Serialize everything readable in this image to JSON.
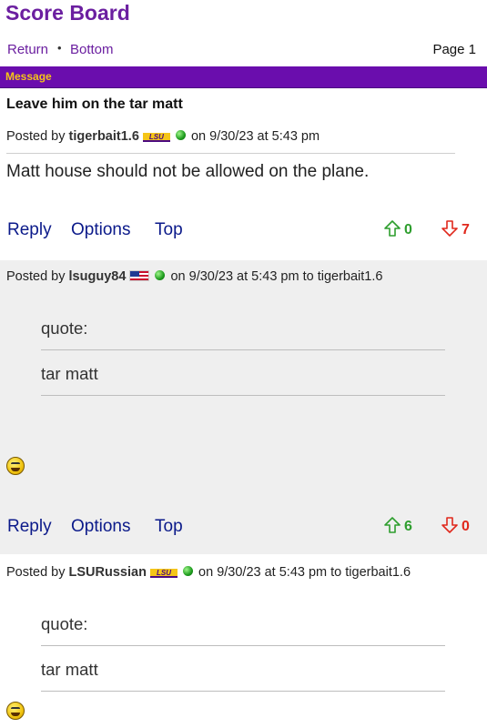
{
  "header": {
    "site_title": "Score Board",
    "nav": {
      "return_label": "Return",
      "separator": "•",
      "bottom_label": "Bottom"
    },
    "page_label": "Page 1"
  },
  "message_bar": {
    "label": "Message"
  },
  "thread": {
    "title": "Leave him on the tar matt"
  },
  "posts": [
    {
      "posted_by_prefix": "Posted by",
      "username": "tigerbait1.6",
      "flag": "LSU",
      "timestamp": "on 9/30/23 at 5:43 pm",
      "body": "Matt house should not be allowed on the plane.",
      "actions": {
        "reply": "Reply",
        "options": "Options",
        "top": "Top"
      },
      "upvotes": "0",
      "downvotes": "7"
    },
    {
      "posted_by_prefix": "Posted by",
      "username": "lsuguy84",
      "flag": "US",
      "timestamp": "on 9/30/23 at 5:43 pm to tigerbait1.6",
      "quote_label": "quote:",
      "quote_text": "tar matt",
      "actions": {
        "reply": "Reply",
        "options": "Options",
        "top": "Top"
      },
      "upvotes": "6",
      "downvotes": "0"
    },
    {
      "posted_by_prefix": "Posted by",
      "username": "LSURussian",
      "flag": "LSU",
      "timestamp": "on 9/30/23 at 5:43 pm to tigerbait1.6",
      "quote_label": "quote:",
      "quote_text": "tar matt"
    }
  ],
  "colors": {
    "brand_purple": "#6a0dad",
    "brand_gold": "#f5c518",
    "upvote_green": "#2e9e2e",
    "downvote_red": "#e0281c",
    "link_blue": "#0b1a8a"
  },
  "icons": {
    "upvote": "arrow-up-outline-icon",
    "downvote": "arrow-down-outline-icon",
    "online": "online-status-dot-icon",
    "emoji": "grimace-emoji-icon"
  }
}
